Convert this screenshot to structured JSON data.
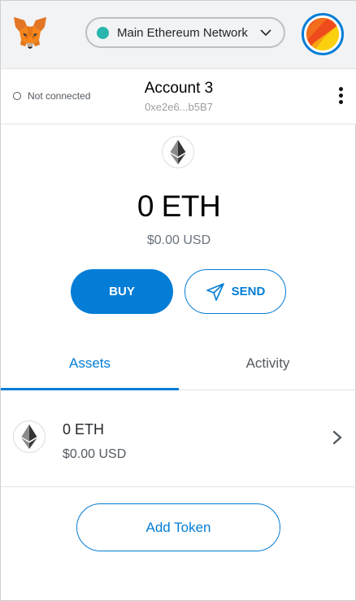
{
  "colors": {
    "accent": "#037dd6",
    "network_dot": "#29b6af",
    "header_bg": "#f2f3f4"
  },
  "header": {
    "logo_icon": "metamask-fox-icon",
    "network": {
      "label": "Main Ethereum Network",
      "dot_icon": "network-status-dot",
      "chevron_icon": "chevron-down-icon"
    },
    "avatar_icon": "account-jazzicon"
  },
  "account": {
    "connection_status": "Not connected",
    "name": "Account 3",
    "address": "0xe2e6...b5B7",
    "menu_icon": "vertical-ellipsis-icon"
  },
  "balance": {
    "icon": "ethereum-icon",
    "primary": "0 ETH",
    "secondary": "$0.00 USD"
  },
  "actions": {
    "buy_label": "BUY",
    "send_label": "SEND",
    "send_icon": "paper-plane-icon"
  },
  "tabs": {
    "assets": "Assets",
    "activity": "Activity",
    "active": "Assets"
  },
  "assets": [
    {
      "icon": "ethereum-icon",
      "primary": "0 ETH",
      "secondary": "$0.00 USD",
      "chevron_icon": "chevron-right-icon"
    }
  ],
  "add_token_label": "Add Token"
}
